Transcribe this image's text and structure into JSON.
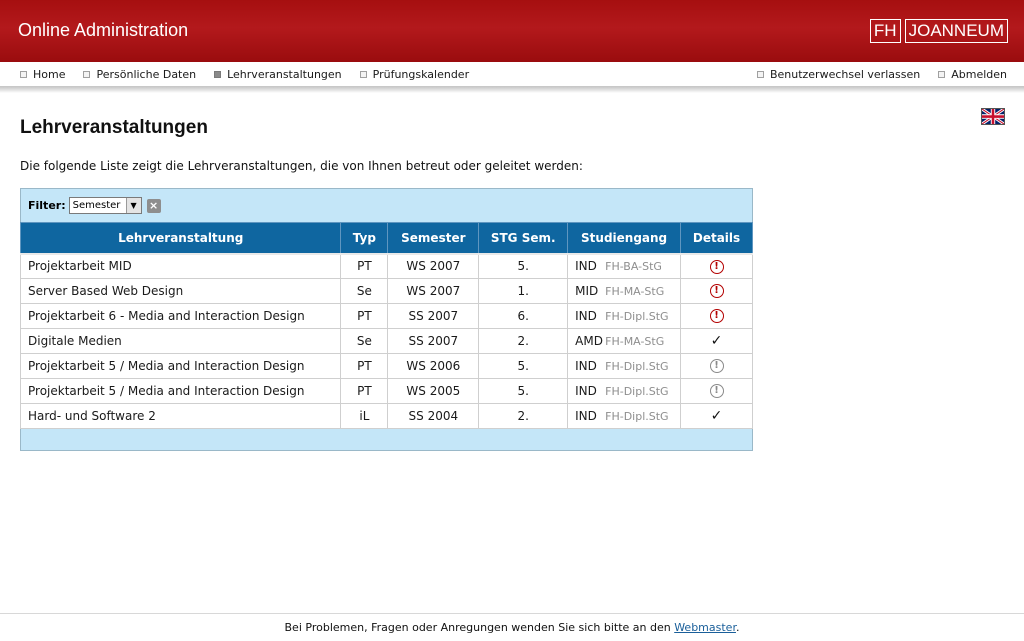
{
  "header": {
    "title": "Online Administration",
    "logo_part1": "FH",
    "logo_part2": "JOANNEUM",
    "background_color": "#a60f10"
  },
  "nav": {
    "left": [
      {
        "label": "Home",
        "active": false
      },
      {
        "label": "Persönliche Daten",
        "active": false
      },
      {
        "label": "Lehrveranstaltungen",
        "active": true
      },
      {
        "label": "Prüfungskalender",
        "active": false
      }
    ],
    "right": [
      {
        "label": "Benutzerwechsel verlassen"
      },
      {
        "label": "Abmelden"
      }
    ]
  },
  "language_flag": "uk-flag-icon",
  "page": {
    "title": "Lehrveranstaltungen",
    "intro": "Die folgende Liste zeigt die Lehrveranstaltungen, die von Ihnen betreut oder geleitet werden:"
  },
  "filter": {
    "label": "Filter:",
    "selected": "Semester"
  },
  "table": {
    "header_color": "#0f66a0",
    "columns": [
      "Lehrveranstaltung",
      "Typ",
      "Semester",
      "STG Sem.",
      "Studiengang",
      "Details"
    ],
    "rows": [
      {
        "name": "Projektarbeit MID",
        "typ": "PT",
        "semester": "WS 2007",
        "stg_sem": "5.",
        "stg": "IND",
        "stg_type": "FH-BA-StG",
        "details": "warning-icon-red"
      },
      {
        "name": "Server Based Web Design",
        "typ": "Se",
        "semester": "WS 2007",
        "stg_sem": "1.",
        "stg": "MID",
        "stg_type": "FH-MA-StG",
        "details": "warning-icon-red"
      },
      {
        "name": "Projektarbeit 6 - Media and Interaction Design",
        "typ": "PT",
        "semester": "SS 2007",
        "stg_sem": "6.",
        "stg": "IND",
        "stg_type": "FH-Dipl.StG",
        "details": "warning-icon-red"
      },
      {
        "name": "Digitale Medien",
        "typ": "Se",
        "semester": "SS 2007",
        "stg_sem": "2.",
        "stg": "AMD",
        "stg_type": "FH-MA-StG",
        "details": "check-icon"
      },
      {
        "name": "Projektarbeit 5 / Media and Interaction Design",
        "typ": "PT",
        "semester": "WS 2006",
        "stg_sem": "5.",
        "stg": "IND",
        "stg_type": "FH-Dipl.StG",
        "details": "warning-icon-grey"
      },
      {
        "name": "Projektarbeit 5 / Media and Interaction Design",
        "typ": "PT",
        "semester": "WS 2005",
        "stg_sem": "5.",
        "stg": "IND",
        "stg_type": "FH-Dipl.StG",
        "details": "warning-icon-grey"
      },
      {
        "name": "Hard- und Software 2",
        "typ": "iL",
        "semester": "SS 2004",
        "stg_sem": "2.",
        "stg": "IND",
        "stg_type": "FH-Dipl.StG",
        "details": "check-icon"
      }
    ]
  },
  "footer": {
    "text": "Bei Problemen, Fragen oder Anregungen wenden Sie sich bitte an den",
    "link": "Webmaster",
    "end": "."
  }
}
